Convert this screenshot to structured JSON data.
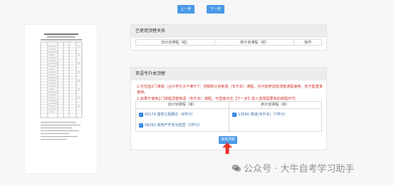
{
  "nav": {
    "prev_label": "上一步",
    "next_label": "下一步"
  },
  "used_relation": {
    "title": "已使用顶替关系",
    "columns": [
      "旧计划课程（组）",
      "新计划课程（组）",
      "操作"
    ]
  },
  "beyond": {
    "title": "英语专升本顶替",
    "notes": [
      "1.可任选2门课程（合计学分大于等于7）顶替新计划英语（专升本）课程，也可放弃选择顶替课程使用，但不能重复使用。",
      "2.如果不使用2门课程顶替英语（专升本）课程，可直接点击【下一步】进入选择需要有的课程环节。"
    ],
    "columns": [
      "旧计划课程（组）",
      "新计划课程（组）"
    ],
    "old_courses": [
      {
        "text": "00174 建筑工程概论（6学分）",
        "checked": true
      },
      {
        "text": "08262 房地产开发与经营（3学分）",
        "checked": true
      }
    ],
    "new_courses": [
      {
        "text": "13000 英语(专升本)（7学分）",
        "checked": true
      }
    ],
    "use_label": "使用顶替"
  },
  "watermark": {
    "text": "公众号 · 大牛自考学习助手",
    "icon": "wechat-icon"
  },
  "colors": {
    "accent": "#4a9ae6",
    "note_red": "#d0342c",
    "arrow_red": "#e8322a"
  }
}
